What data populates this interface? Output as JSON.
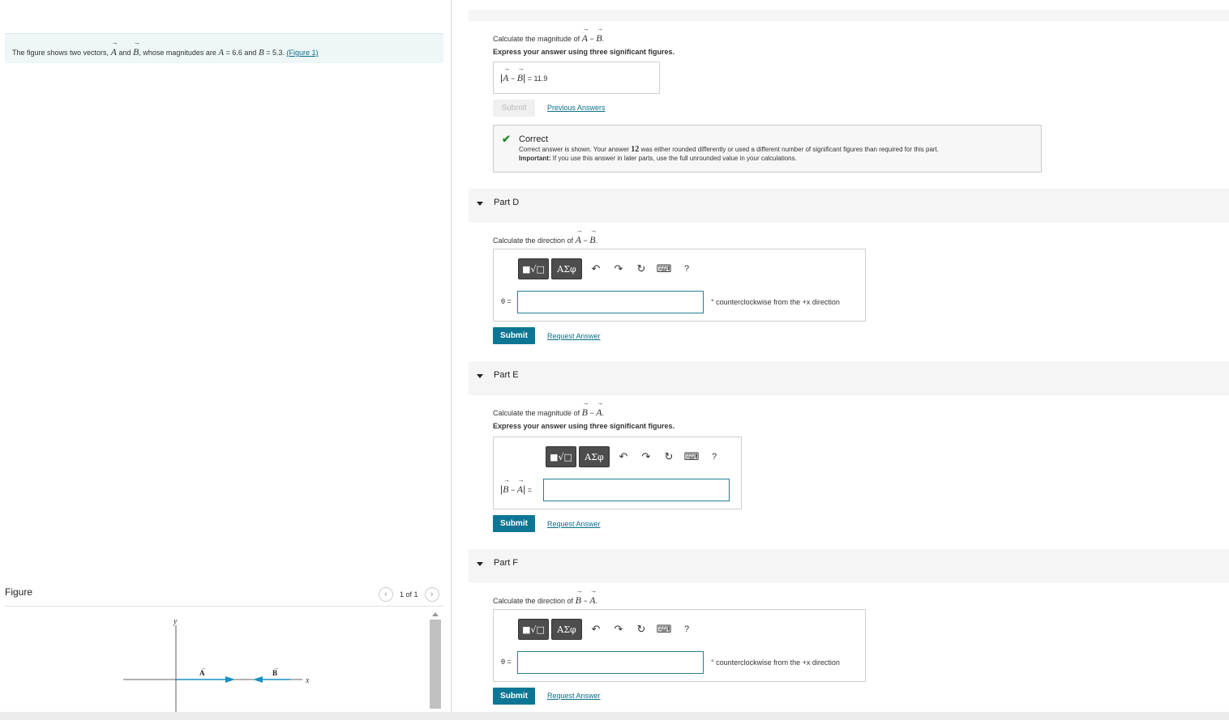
{
  "intro": {
    "prefix": "The figure shows two vectors,",
    "vecA": "A",
    "and": "and",
    "vecB": "B",
    "mid": ", whose magnitudes are",
    "magA": "A",
    "eqA": "= 6.6 and",
    "magB": "B",
    "eqB": "= 5.3.",
    "figure_link": "(Figure 1)"
  },
  "figure": {
    "label": "Figure",
    "pager": "1 of 1",
    "prev_icon": "chevron-left-icon",
    "next_icon": "chevron-right-icon",
    "axis_y": "y",
    "axis_x": "x",
    "vector_a_label": "A",
    "vector_b_label": "B",
    "arrow_color": "#1b8fc8"
  },
  "partC": {
    "question_prefix": "Calculate the magnitude of",
    "q_vec1": "A",
    "q_minus": "−",
    "q_vec2": "B",
    "q_end": ".",
    "instruction": "Express your answer using three significant figures.",
    "eq_vec1": "A",
    "eq_vec2": "B",
    "eq_sign": "=",
    "answer_value": "11.9",
    "submit_label": "Submit",
    "previous_link": "Previous Answers",
    "feedback": {
      "icon": "check-icon",
      "title": "Correct",
      "line1_prefix": "Correct answer is shown. Your answer",
      "line1_answer": "12",
      "line1_suffix": "was either rounded differently or used a different number of significant figures than required for this part.",
      "line2_bold": "Important:",
      "line2_rest": "If you use this answer in later parts, use the full unrounded value in your calculations."
    }
  },
  "partD": {
    "label": "Part D",
    "question_prefix": "Calculate the direction of",
    "q_vec1": "A",
    "q_minus": "−",
    "q_vec2": "B",
    "q_end": ".",
    "theta_label": "θ =",
    "unit_text": "° counterclockwise from the +x direction",
    "submit_label": "Submit",
    "request_link": "Request Answer"
  },
  "partE": {
    "label": "Part E",
    "question_prefix": "Calculate the magnitude of",
    "q_vec1": "B",
    "q_minus": "−",
    "q_vec2": "A",
    "q_end": ".",
    "instruction": "Express your answer using three significant figures.",
    "eq_vec1": "B",
    "eq_vec2": "A",
    "eq_sign": "=",
    "submit_label": "Submit",
    "request_link": "Request Answer"
  },
  "partF": {
    "label": "Part F",
    "question_prefix": "Calculate the direction of",
    "q_vec1": "B",
    "q_minus": "−",
    "q_vec2": "A",
    "q_end": ".",
    "theta_label": "θ =",
    "unit_text": "° counterclockwise from the +x direction",
    "submit_label": "Submit",
    "request_link": "Request Answer"
  },
  "toolbar": {
    "templates_icon": "templates-icon",
    "greek_label": "ΑΣφ",
    "undo_icon": "undo-icon",
    "redo_icon": "redo-icon",
    "reset_icon": "reset-icon",
    "keyboard_icon": "keyboard-icon",
    "help_label": "?"
  }
}
